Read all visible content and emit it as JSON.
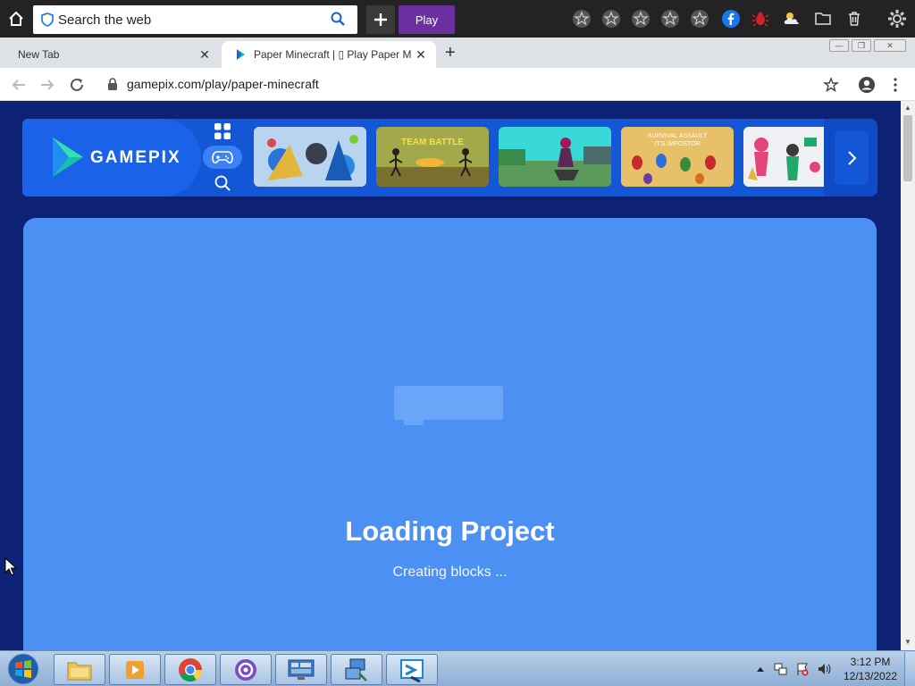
{
  "toolbar": {
    "search_placeholder": "Search the web",
    "play_label": "Play",
    "extension_icons": [
      "star-icon",
      "star-icon",
      "star-icon",
      "star-icon",
      "star-icon",
      "facebook-icon",
      "bug-icon",
      "weather-icon",
      "folder-icon",
      "trash-icon",
      "gear-icon"
    ]
  },
  "tabs": [
    {
      "title": "New Tab",
      "active": false
    },
    {
      "title": "Paper Minecraft | ▯ Play Paper M",
      "active": true
    }
  ],
  "address": {
    "url": "gamepix.com/play/paper-minecraft"
  },
  "gamepix": {
    "logo_text": "GAMEPIX",
    "thumbnails": [
      {
        "name": "stick-fighters",
        "color": "#8fb6e6"
      },
      {
        "name": "team-battle",
        "color": "#9aa23a"
      },
      {
        "name": "biker",
        "color": "#4bc1c4"
      },
      {
        "name": "impostor",
        "color": "#e0b45a"
      },
      {
        "name": "ragdoll",
        "color": "#e7e7ee"
      }
    ]
  },
  "game": {
    "loading_title": "Loading Project",
    "loading_status": "Creating blocks ..."
  },
  "taskbar": {
    "time": "3:12 PM",
    "date": "12/13/2022"
  },
  "colors": {
    "page_bg": "#0d2274",
    "game_bg": "#4d90f4",
    "play_btn": "#6b2fa0",
    "gamepix_blue": "#1457d6"
  }
}
